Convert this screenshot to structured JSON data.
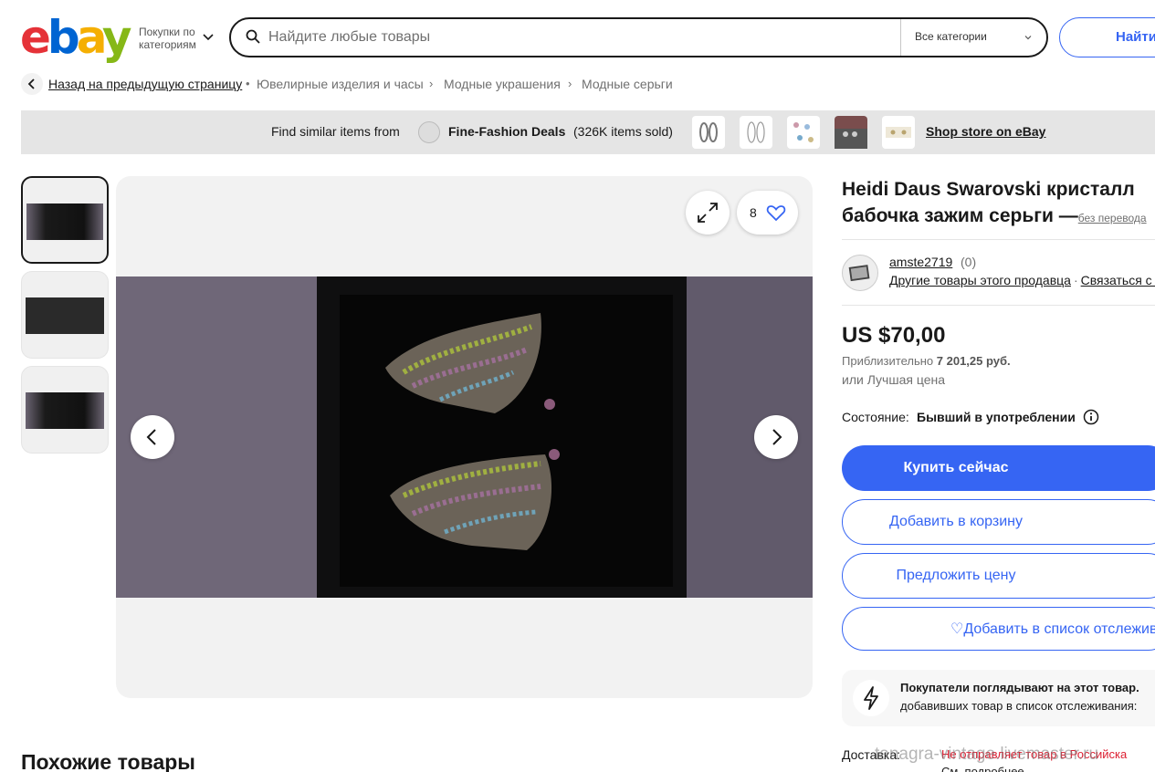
{
  "header": {
    "logo": {
      "e": "e",
      "b": "b",
      "a": "a",
      "y": "y"
    },
    "shop_by_category": "Покупки по категориям",
    "search_placeholder": "Найдите любые товары",
    "category_select": "Все категории",
    "find_button": "Найти"
  },
  "breadcrumb": {
    "back": "Назад на предыдущую страницу",
    "items": [
      "Ювелирные изделия и часы",
      "Модные украшения",
      "Модные серьги"
    ]
  },
  "store_banner": {
    "prefix": "Find similar items from",
    "store_name": "Fine-Fashion Deals",
    "sold_count": "(326K items sold)",
    "shop_link": "Shop store on eBay"
  },
  "gallery": {
    "watch_count": "8",
    "thumbnail_count": 3
  },
  "listing": {
    "title_line1": "Heidi Daus Swarovski кристалл",
    "title_line2": "бабочка зажим серьги —",
    "no_translation": "без перевода"
  },
  "seller": {
    "name": "amste2719",
    "score": "(0)",
    "other_items": "Другие товары этого продавца",
    "contact": "Связаться с п"
  },
  "pricing": {
    "price": "US $70,00",
    "approx_label": "Приблизительно",
    "approx_value": "7 201,25 руб.",
    "best_offer": "или Лучшая цена"
  },
  "condition": {
    "label": "Состояние:",
    "value": "Бывший в употреблении"
  },
  "actions": {
    "buy_now": "Купить сейчас",
    "add_to_cart": "Добавить в корзину",
    "make_offer": "Предложить цену",
    "add_to_watchlist": "♡Добавить в список отслежив"
  },
  "notice": {
    "title": "Покупатели поглядывают на этот товар.",
    "subtitle": "добавивших товар в список отслеживания:"
  },
  "shipping": {
    "label": "Доставка:",
    "value": "Не отправляет товар в Российска",
    "more": "См. подробнее"
  },
  "similar_items_heading": "Похожие товары",
  "watermark": "tanagra-vintage.livemaster.ru",
  "colors": {
    "primary": "#3665f3",
    "banner_bg": "#e5e5e5",
    "stage_bg": "#f2f2f2",
    "shipping_red": "#dd1e31"
  }
}
